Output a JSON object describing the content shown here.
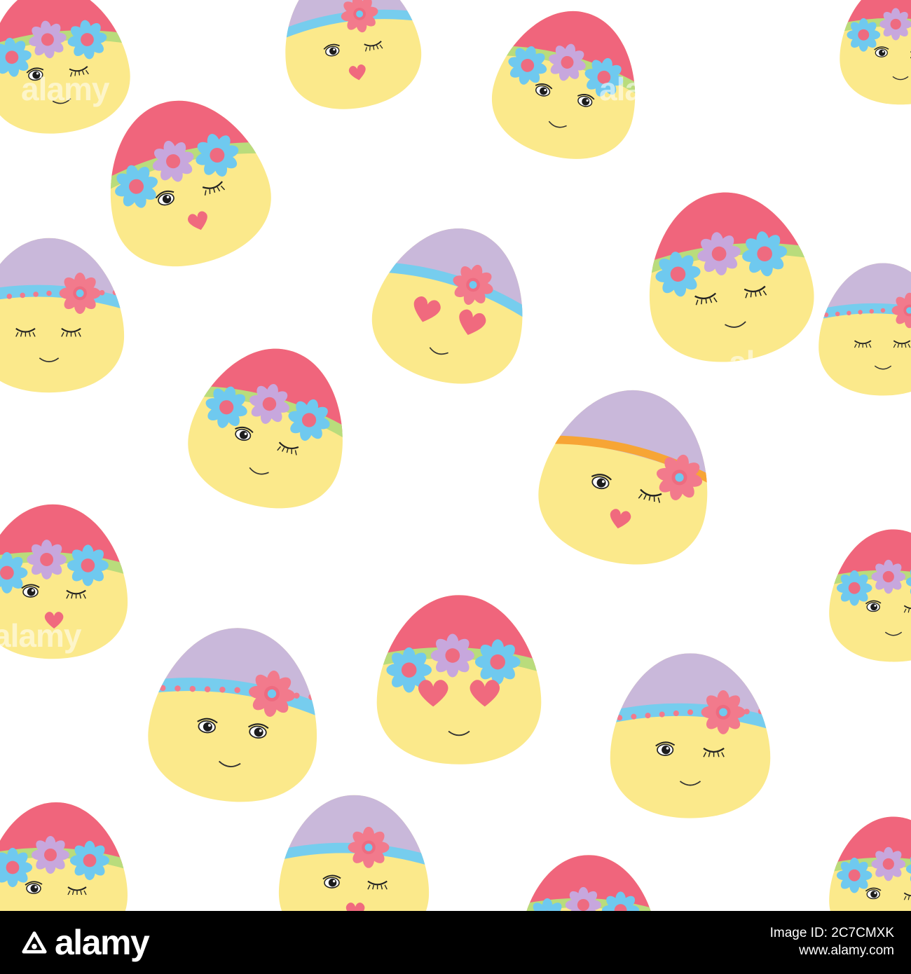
{
  "watermark": {
    "text": "alamy"
  },
  "footer": {
    "logo_text": "alamy",
    "image_id_label": "Image ID:",
    "image_id": "2C7CMXK",
    "site_url": "www.alamy.com"
  },
  "palette": {
    "face_yellow": "#fbe98b",
    "cap_pink": "#f0657c",
    "cap_lavender": "#c9b8da",
    "band_blue": "#76cdee",
    "band_orange": "#f7a535",
    "petal_blue": "#6fc9ef",
    "petal_lilac": "#c7a7dd",
    "petal_pink": "#f27a8c",
    "flower_center": "#ee6b80",
    "heart": "#f06a7e",
    "leaf_green": "#b9dc7c",
    "footer_bg": "#000000"
  },
  "icons": [
    "easter-egg-face",
    "flower",
    "heart",
    "alamy-logo-icon"
  ]
}
